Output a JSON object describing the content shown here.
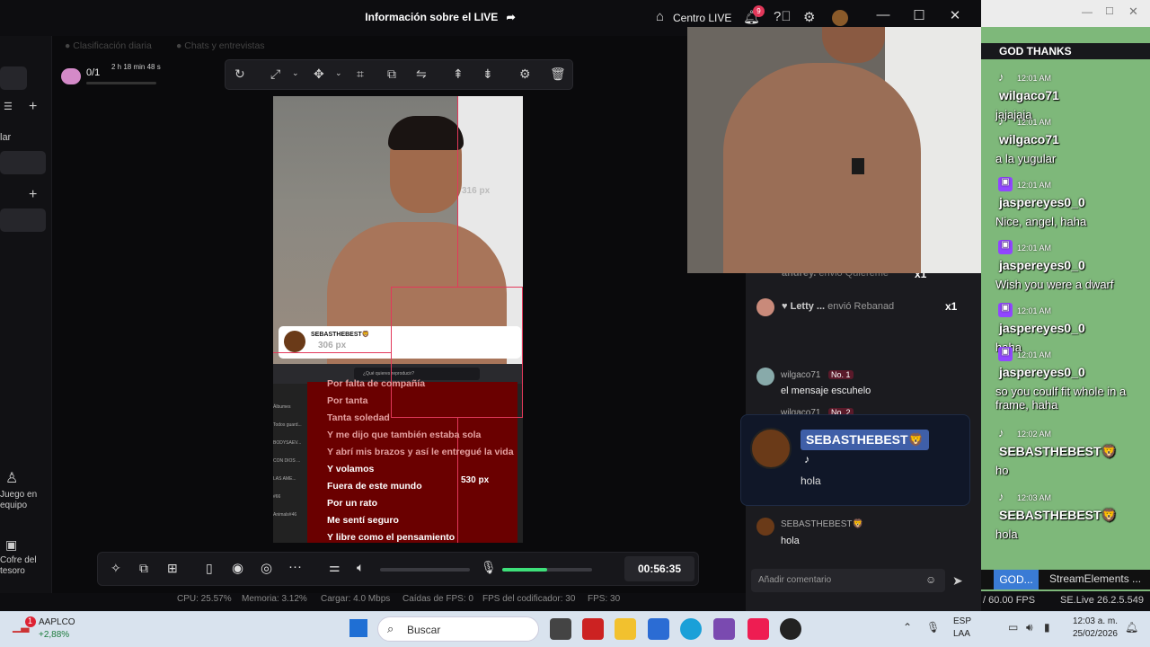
{
  "window": {
    "title": "Información sobre el LIVE",
    "centro_live": "Centro LIVE",
    "notif_count": "9"
  },
  "tabs": [
    "Clasificación diaria",
    "Chats y entrevistas"
  ],
  "left": {
    "counter": "0/1",
    "duration": "2 h 18 min 48 s",
    "label_lar": "lar",
    "juego": "Juego en equipo",
    "cofre": "Cofre del tesoro"
  },
  "preview": {
    "card_user": "SEBASTHEBEST🦁",
    "card_px": "306 px",
    "right_px": "316 px",
    "bottom_px": "530 px",
    "search": "¿Qué quieres reproducir?",
    "side_items": [
      "Álbumes",
      "Todos guard...",
      "BODYSAEV...",
      "CON DIOS ...",
      "LAS AME...",
      "#66",
      "Animals#46"
    ],
    "lyrics": [
      {
        "text": "Por falta de compañía",
        "hl": false
      },
      {
        "text": "Por tanta",
        "hl": false
      },
      {
        "text": "Tanta soledad",
        "hl": false
      },
      {
        "text": "Y me dijo que también estaba sola",
        "hl": false
      },
      {
        "text": "Y abrí mis brazos y así le entregué la vida",
        "hl": false
      },
      {
        "text": "Y volamos",
        "hl": true
      },
      {
        "text": "Fuera de este mundo",
        "hl": true
      },
      {
        "text": "Por un rato",
        "hl": true
      },
      {
        "text": "Me sentí seguro",
        "hl": true
      },
      {
        "text": "Y libre como el pensamiento",
        "hl": true
      }
    ]
  },
  "controls": {
    "time": "00:56:35",
    "mic_level": 0.5
  },
  "stats": {
    "cpu": "CPU: 25.57%",
    "mem": "Memoria: 3.12%",
    "load": "Cargar: 4.0 Mbps",
    "fps_drop": "Caídas de FPS: 0",
    "enc_fps": "FPS del codificador: 30",
    "fps": "FPS: 30"
  },
  "gifts": [
    {
      "user": "andrey.",
      "action": "envió Quiéreme",
      "count": "x1"
    },
    {
      "user": "Letty ...",
      "action": "envió Rebanad",
      "count": "x1"
    }
  ],
  "comments": [
    {
      "user": "wilgaco71",
      "rank": "No. 1",
      "text": "el mensaje escuhelo"
    },
    {
      "user": "wilgaco71",
      "rank": "No. 2",
      "text": ""
    },
    {
      "user": "SEBASTHEBEST",
      "rank": "",
      "text": "hola"
    }
  ],
  "gift_popup": {
    "user": "SEBASTHEBEST🦁",
    "text": "hola"
  },
  "comment_placeholder": "Añadir comentario",
  "stream_overlay": {
    "header": "GOD THANKS",
    "tiktok_count": "2",
    "youtube_count": "0",
    "messages": [
      {
        "time": "12:01 AM",
        "user": "wilgaco71",
        "text": "jajajaja",
        "platform": "tiktok"
      },
      {
        "time": "12:01 AM",
        "user": "wilgaco71",
        "text": "a la yugular",
        "platform": "tiktok"
      },
      {
        "time": "12:01 AM",
        "user": "jaspereyes0_0",
        "text": "Nice, angel, haha",
        "platform": "twitch"
      },
      {
        "time": "12:01 AM",
        "user": "jaspereyes0_0",
        "text": "Wish you were a dwarf",
        "platform": "twitch"
      },
      {
        "time": "12:01 AM",
        "user": "jaspereyes0_0",
        "text": "haha",
        "platform": "twitch"
      },
      {
        "time": "12:01 AM",
        "user": "jaspereyes0_0",
        "text": "so you coulf fit whole in a frame, haha",
        "platform": "twitch"
      },
      {
        "time": "12:02 AM",
        "user": "SEBASTHEBEST🦁",
        "text": "ho",
        "platform": "tiktok"
      },
      {
        "time": "12:03 AM",
        "user": "SEBASTHEBEST🦁",
        "text": "hola",
        "platform": "tiktok"
      }
    ],
    "bottom_tabs": [
      "GOD...",
      "StreamElements ..."
    ],
    "fps": "/ 60.00 FPS",
    "version": "SE.Live 26.2.5.549"
  },
  "taskbar": {
    "stock": "AAPLCO",
    "stock_change": "+2,88%",
    "stock_badge": "1",
    "search": "Buscar",
    "lang": "ESP",
    "lang2": "LAA",
    "time": "12:03 a. m.",
    "date": "25/02/2026"
  },
  "colors": {
    "accent": "#e2385a",
    "stream_bg": "#7eb87a",
    "lyrics_bg": "#6a0000",
    "twitch": "#9146ff"
  }
}
